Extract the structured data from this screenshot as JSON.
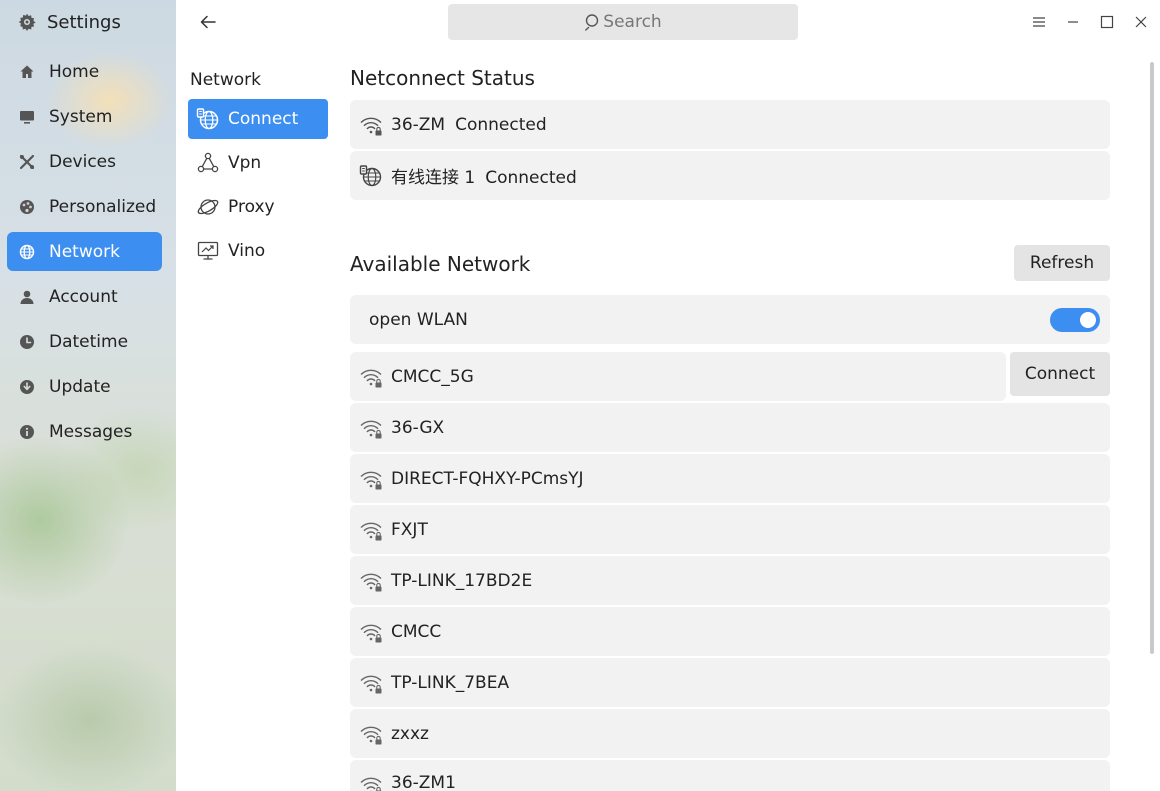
{
  "app": {
    "title": "Settings"
  },
  "sidebar": {
    "items": [
      {
        "label": "Home",
        "icon": "home-icon"
      },
      {
        "label": "System",
        "icon": "monitor-icon"
      },
      {
        "label": "Devices",
        "icon": "devices-icon"
      },
      {
        "label": "Personalized",
        "icon": "palette-icon"
      },
      {
        "label": "Network",
        "icon": "globe-icon",
        "active": true
      },
      {
        "label": "Account",
        "icon": "user-icon"
      },
      {
        "label": "Datetime",
        "icon": "clock-icon"
      },
      {
        "label": "Update",
        "icon": "update-icon"
      },
      {
        "label": "Messages",
        "icon": "info-icon"
      }
    ]
  },
  "search": {
    "placeholder": "Search"
  },
  "subnav": {
    "title": "Network",
    "items": [
      {
        "label": "Connect",
        "icon": "connect-icon",
        "active": true
      },
      {
        "label": "Vpn",
        "icon": "vpn-icon"
      },
      {
        "label": "Proxy",
        "icon": "proxy-icon"
      },
      {
        "label": "Vino",
        "icon": "vino-icon"
      }
    ]
  },
  "status": {
    "title": "Netconnect Status",
    "items": [
      {
        "name": "36-ZM",
        "state": "Connected",
        "icon": "wifi-lock-icon"
      },
      {
        "name": "有线连接 1",
        "state": "Connected",
        "icon": "wired-globe-icon"
      }
    ]
  },
  "available": {
    "title": "Available Network",
    "refresh_label": "Refresh",
    "wlan_label": "open WLAN",
    "wlan_on": true,
    "connect_label": "Connect",
    "networks": [
      "CMCC_5G",
      "36-GX",
      "DIRECT-FQHXY-PCmsYJ",
      "FXJT",
      "TP-LINK_17BD2E",
      "CMCC",
      "TP-LINK_7BEA",
      "zxxz",
      "36-ZM1"
    ]
  },
  "colors": {
    "accent": "#3c8ef0",
    "card": "#f2f2f2",
    "button": "#e4e4e4"
  }
}
